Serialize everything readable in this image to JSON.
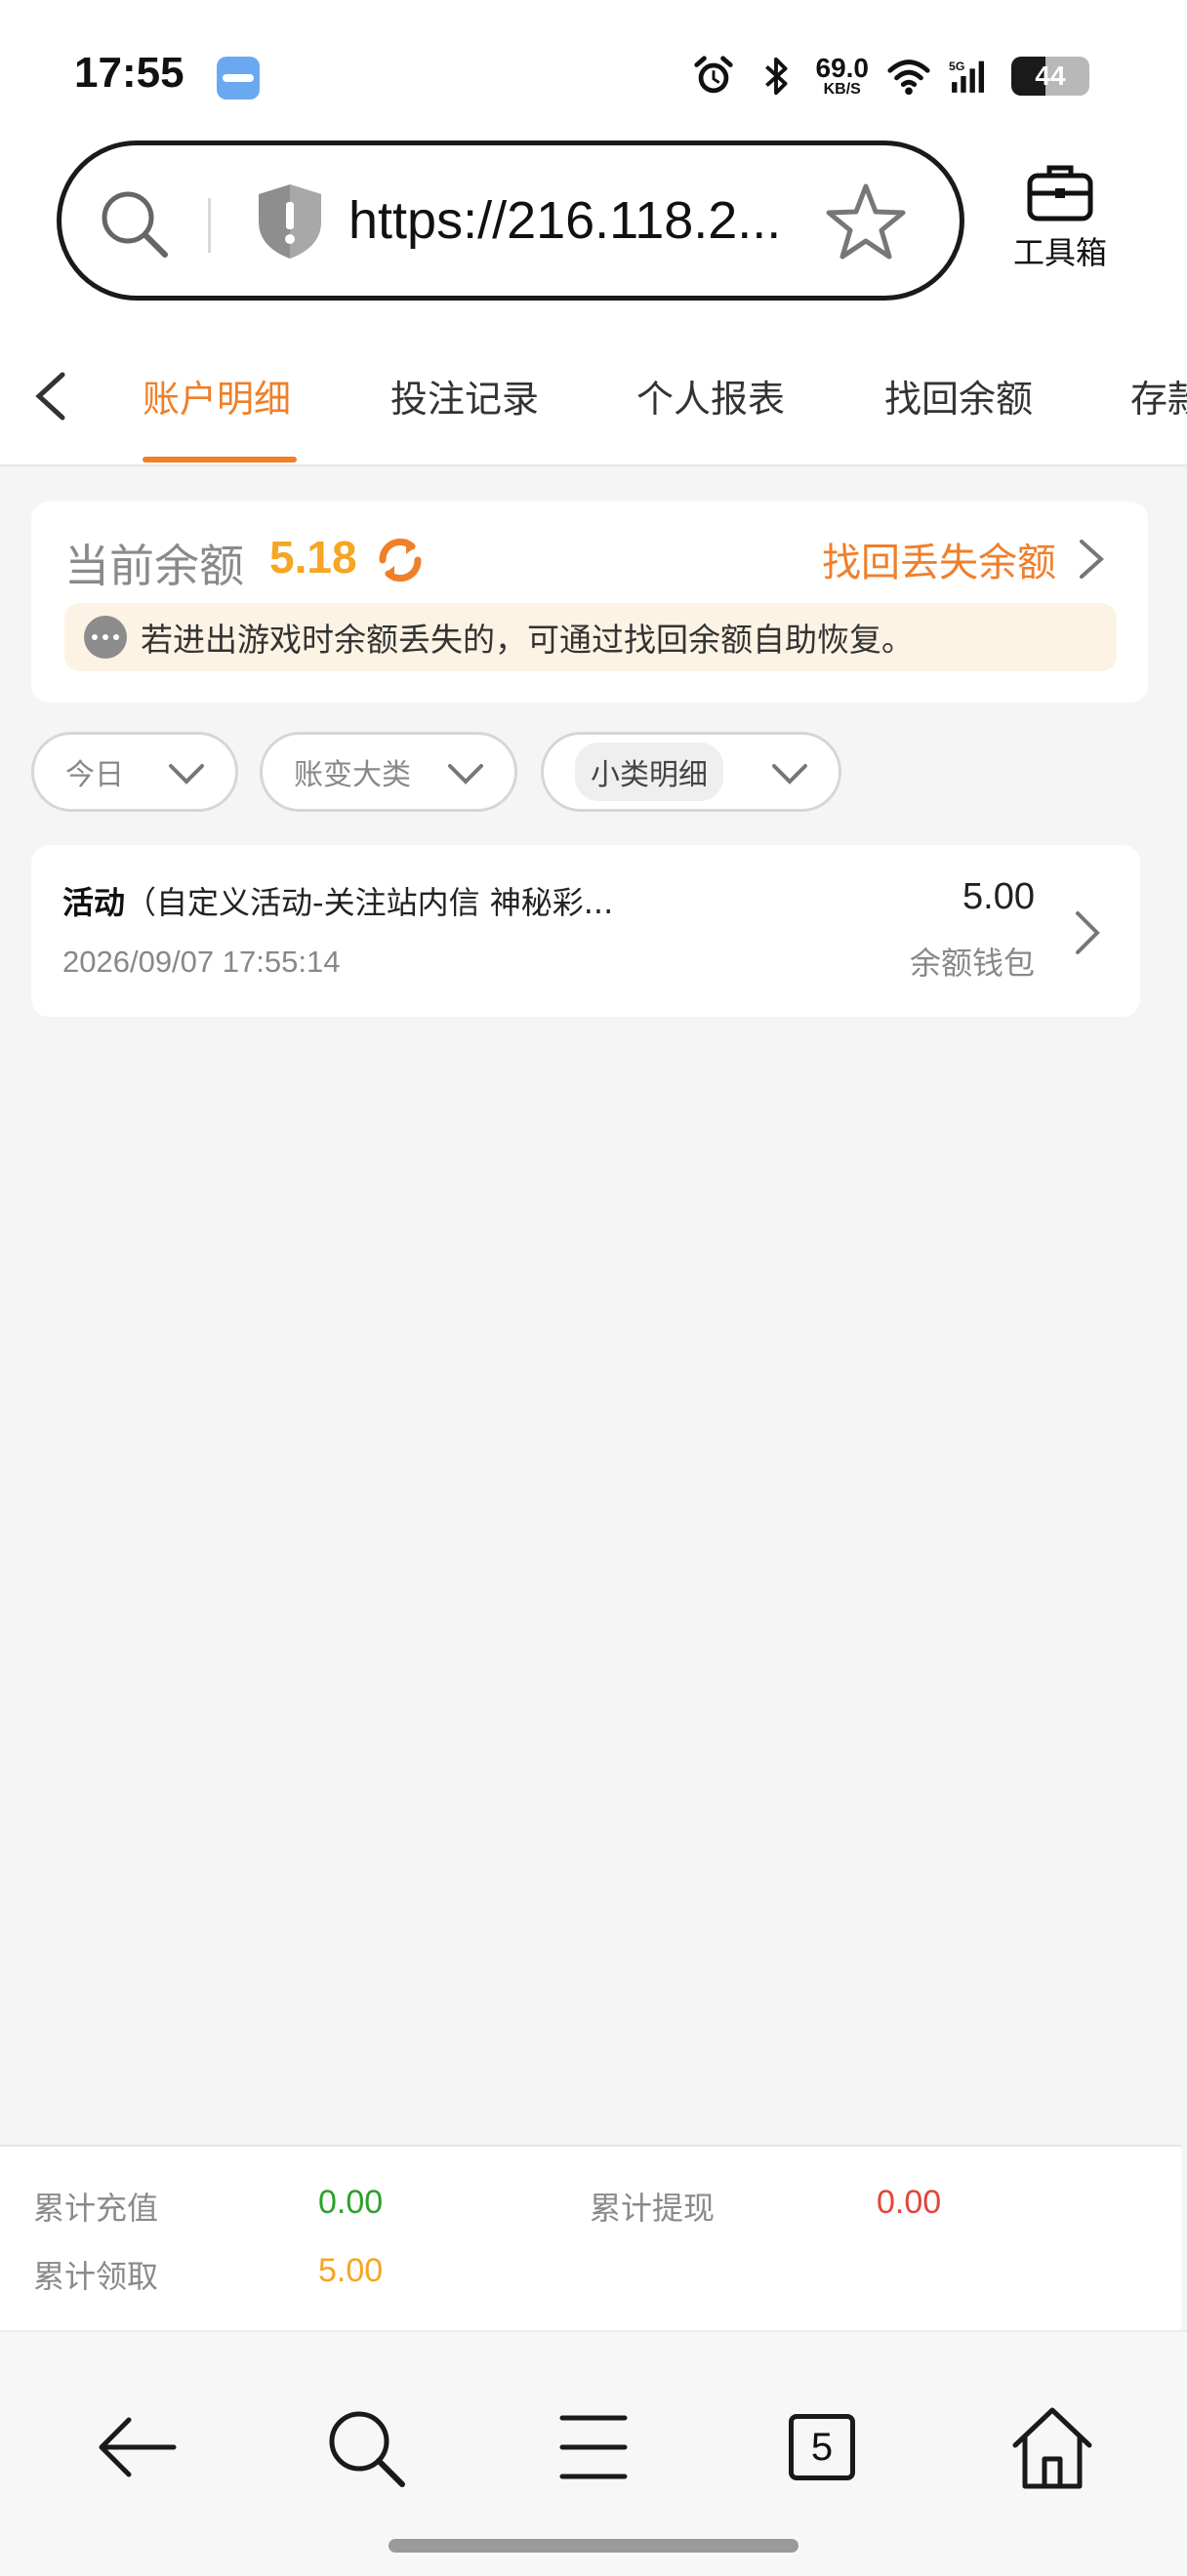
{
  "status_bar": {
    "time": "17:55",
    "net_speed_value": "69.0",
    "net_speed_unit": "KB/S",
    "network": "5G",
    "battery": "44"
  },
  "browser": {
    "url": "https://216.118.2...",
    "toolbox_label": "工具箱"
  },
  "tabs": [
    {
      "label": "账户明细",
      "active": true
    },
    {
      "label": "投注记录",
      "active": false
    },
    {
      "label": "个人报表",
      "active": false
    },
    {
      "label": "找回余额",
      "active": false
    },
    {
      "label": "存款",
      "active": false
    }
  ],
  "balance": {
    "label": "当前余额",
    "value": "5.18",
    "recover_link": "找回丢失余额",
    "notice": "若进出游戏时余额丢失的，可通过找回余额自助恢复。"
  },
  "filters": {
    "date": "今日",
    "category": "账变大类",
    "subcategory": "小类明细"
  },
  "records": [
    {
      "type": "活动",
      "detail": "（自定义活动-关注站内信 神秘彩...",
      "time": "2026/09/07 17:55:14",
      "amount": "5.00",
      "wallet": "余额钱包"
    }
  ],
  "summary": {
    "recharge_label": "累计充值",
    "recharge_value": "0.00",
    "withdraw_label": "累计提现",
    "withdraw_value": "0.00",
    "claim_label": "累计领取",
    "claim_value": "5.00"
  },
  "bottom_nav": {
    "tab_count": "5"
  },
  "colors": {
    "accent": "#f07f2a",
    "balance": "#f5a623",
    "recharge": "#2ca02c",
    "withdraw": "#e0463c",
    "claim": "#f5a623"
  }
}
